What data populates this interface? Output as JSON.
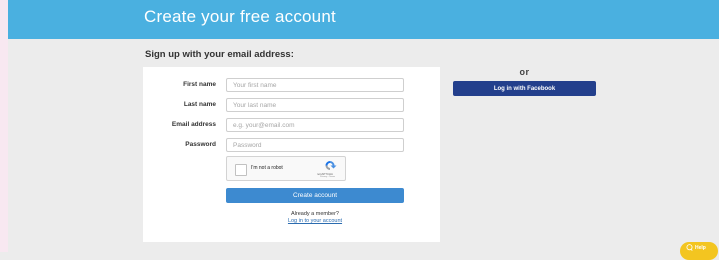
{
  "header": {
    "title": "Create your free account"
  },
  "signup": {
    "heading": "Sign up with your email address:",
    "fields": [
      {
        "label": "First name",
        "placeholder": "Your first name"
      },
      {
        "label": "Last name",
        "placeholder": "Your last name"
      },
      {
        "label": "Email address",
        "placeholder": "e.g. your@email.com"
      },
      {
        "label": "Password",
        "placeholder": "Password"
      }
    ],
    "recaptcha": {
      "label": "I'm not a robot",
      "brand": "reCAPTCHA",
      "terms": "Privacy - Terms"
    },
    "create_button": "Create account",
    "member_text": "Already a member?",
    "login_link": "Log in to your account"
  },
  "alt": {
    "or_text": "or",
    "facebook_button": "Log in with Facebook"
  },
  "help": {
    "label": "Help"
  },
  "colors": {
    "header": "#4ab0e0",
    "primary_button": "#3d8ad0",
    "facebook": "#233f8c",
    "help": "#f3c520"
  }
}
